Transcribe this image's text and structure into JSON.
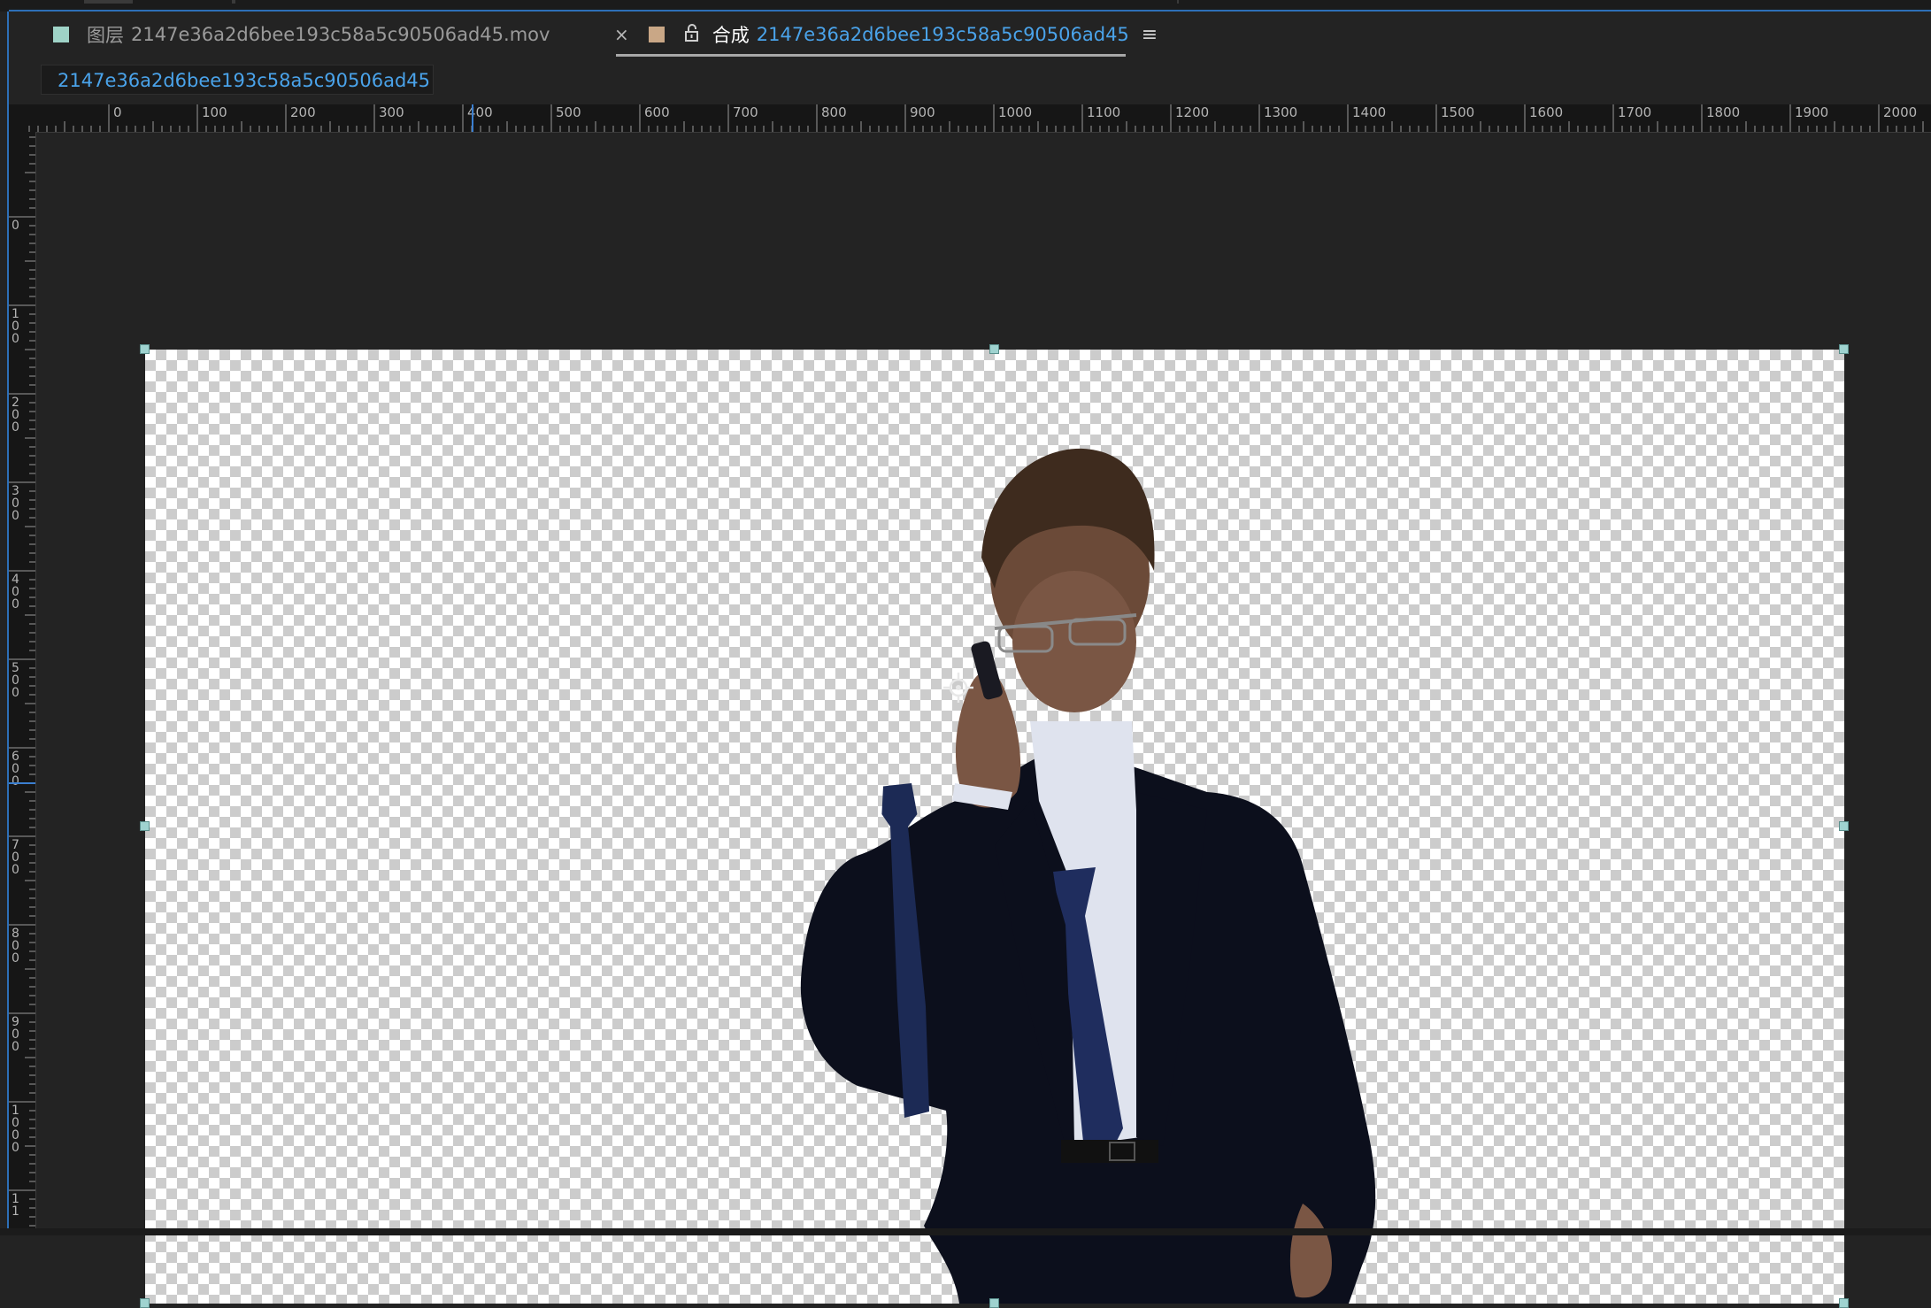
{
  "tabs": {
    "layer_tab": {
      "prefix": "图层",
      "name": "2147e36a2d6bee193c58a5c90506ad45.mov",
      "swatch_color": "#9fd3c7"
    },
    "comp_tab": {
      "close": "×",
      "lock_icon": "unlock-icon",
      "title": "合成",
      "name": "2147e36a2d6bee193c58a5c90506ad45",
      "menu": "≡",
      "swatch_color": "#c9a786"
    }
  },
  "breadcrumb": {
    "label": "2147e36a2d6bee193c58a5c90506ad45"
  },
  "rulers": {
    "horizontal": [
      "0",
      "100",
      "200",
      "300",
      "400",
      "500",
      "600",
      "700",
      "800",
      "900",
      "1000",
      "1100",
      "1200",
      "1300",
      "1400",
      "1500",
      "1600",
      "1700",
      "1800",
      "1900",
      "2000"
    ],
    "vertical": [
      "0",
      "100",
      "200",
      "300",
      "400",
      "500",
      "600",
      "700",
      "800",
      "900",
      "1000",
      "11"
    ]
  },
  "colors": {
    "accent": "#2d6fb7",
    "link": "#4aa3ea",
    "handle": "#9fd3d0"
  },
  "viewer": {
    "content": "keyed footage of man in dark suit talking on phone over transparency grid",
    "anchor_icon": "anchor-point-icon"
  }
}
